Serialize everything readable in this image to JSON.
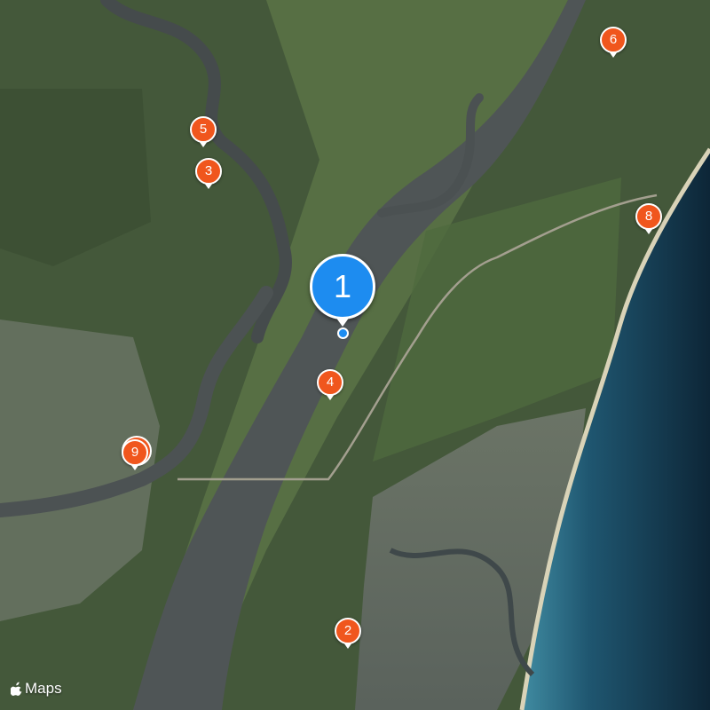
{
  "map": {
    "attribution_label": "Maps",
    "primary_marker": {
      "label": "1",
      "color": "#1d8cf0"
    },
    "markers": [
      {
        "id": "2",
        "label": "2",
        "color": "#f0561d"
      },
      {
        "id": "3",
        "label": "3",
        "color": "#f0561d"
      },
      {
        "id": "4",
        "label": "4",
        "color": "#f0561d"
      },
      {
        "id": "5",
        "label": "5",
        "color": "#f0561d"
      },
      {
        "id": "6",
        "label": "6",
        "color": "#f0561d"
      },
      {
        "id": "8",
        "label": "8",
        "color": "#f0561d"
      },
      {
        "id": "9",
        "label": "9",
        "color": "#f0561d",
        "stacked": true
      }
    ],
    "icons": {
      "attribution_logo": "apple-logo-icon",
      "current_location": "location-dot-icon"
    },
    "colors": {
      "land": "#44583a",
      "marsh": "#5f7a4a",
      "river": "#4f5556",
      "ocean_shallow": "#2f6f86",
      "ocean_deep": "#0f2c40",
      "beach": "#d9d3b8",
      "town": "#8a8f86"
    }
  }
}
